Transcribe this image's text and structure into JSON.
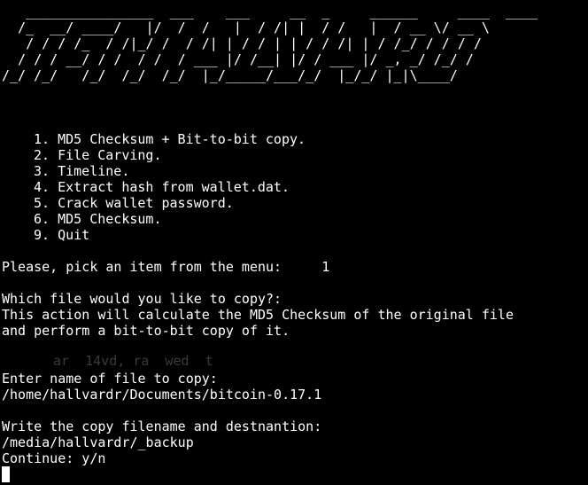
{
  "banner": [
    "   ________________  ___    ___     __  _     ______     ____  ____",
    "  /_  __/ ____/   |/  /  /   |  / /| |  / /   |  / __ \\/ __ \\",
    "   / / / /_  / /|_/ /  / /| | / / | | / / /| | / /_/ / / / /",
    "  / / / __/ / /  / /  / ___ |/ /__| |/ / ___ |/ _, _/ /_/ /",
    "/_/ /_/   /_/  /_/  /_/  |_/_____/___/_/  |_/_/ |_|\\____/"
  ],
  "menu": [
    "1. MD5 Checksum + Bit-to-bit copy.",
    "2. File Carving.",
    "3. Timeline.",
    "4. Extract hash from wallet.dat.",
    "5. Crack wallet password.",
    "6. MD5 Checksum.",
    "9. Quit"
  ],
  "pick_prompt": "Please, pick an item from the menu:",
  "pick_value": "1",
  "copy_question": "Which file would you like to copy?:",
  "info_line1": "This action will calculate the MD5 Checksum of the original file",
  "info_line2": "and perform a bit-to-bit copy of it.",
  "ghost_text": "ar  14vd, ra  wed  t",
  "enter_name_prompt": "Enter name of file to copy:",
  "source_path": "/home/hallvardr/Documents/bitcoin-0.17.1",
  "dest_prompt": "Write the copy filename and destnantion:",
  "dest_path": "/media/hallvardr/_backup",
  "continue_prompt": "Continue: y/n"
}
